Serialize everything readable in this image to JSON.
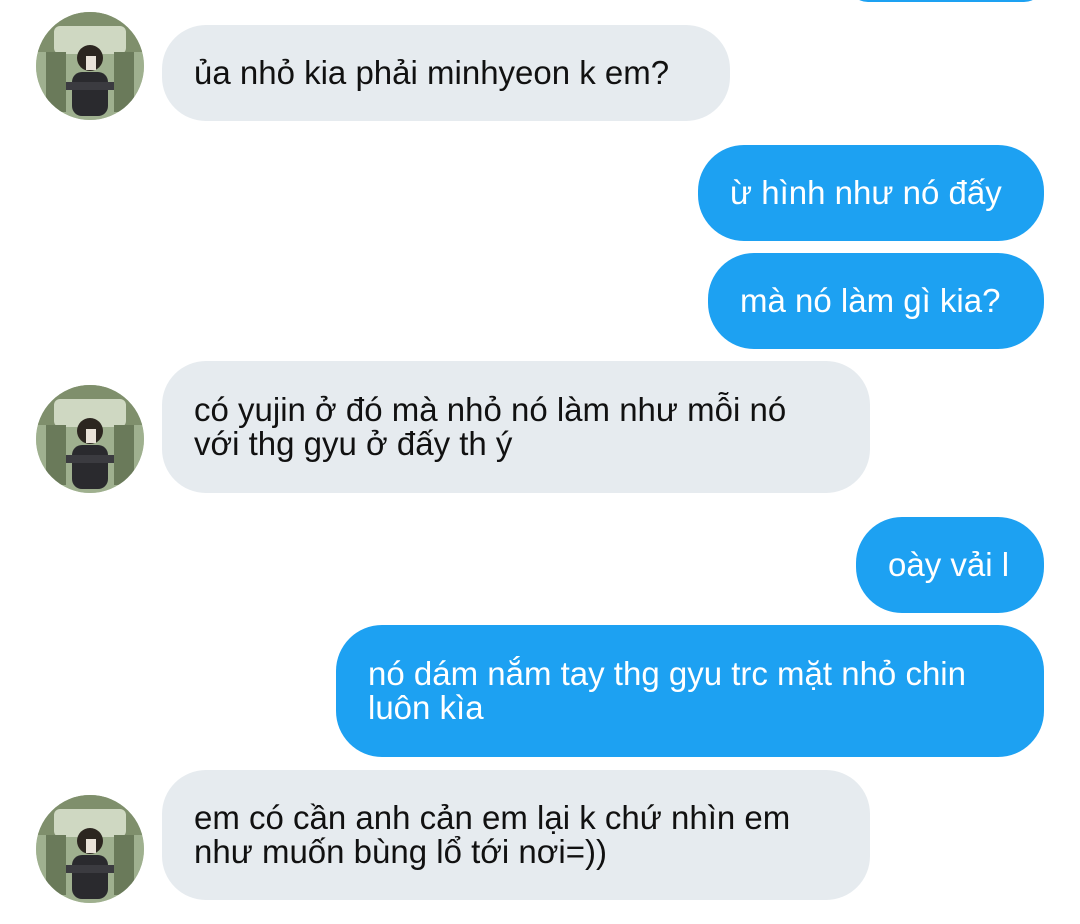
{
  "conversation": {
    "messages": [
      {
        "sender": "them",
        "text": "ủa nhỏ kia phải minhyeon k em?"
      },
      {
        "sender": "me",
        "text": "ừ hình như nó đấy"
      },
      {
        "sender": "me",
        "text": "mà nó làm gì kia?"
      },
      {
        "sender": "them",
        "text": "có yujin ở đó mà nhỏ nó làm như mỗi nó với thg gyu ở đấy th ý"
      },
      {
        "sender": "me",
        "text": "oày vải l"
      },
      {
        "sender": "me",
        "text": "nó dám nắm tay thg gyu trc mặt nhỏ chin luôn kìa"
      },
      {
        "sender": "them",
        "text": "em có cần anh cản em lại k chứ nhìn em như muốn bùng lổ tới nơi=))"
      }
    ]
  },
  "colors": {
    "outgoing_bubble": "#1da1f2",
    "incoming_bubble": "#e6ebef"
  },
  "icons": {
    "contact_avatar": "avatar-photo-icon"
  }
}
